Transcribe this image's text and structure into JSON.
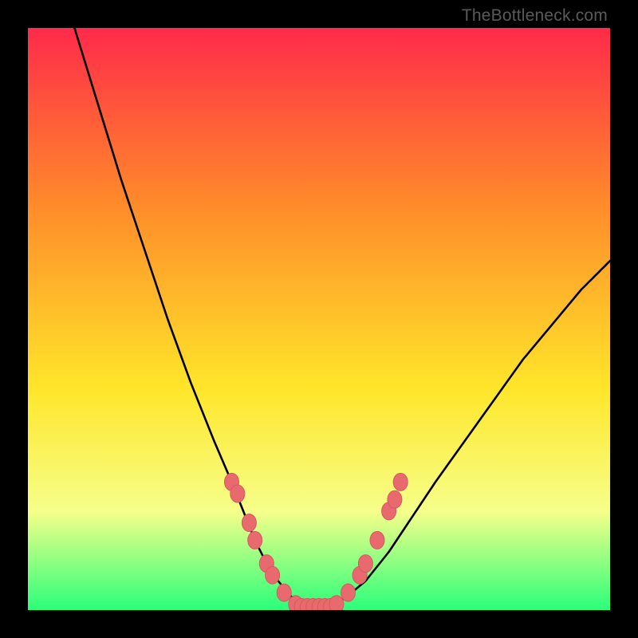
{
  "watermark": "TheBottleneck.com",
  "colors": {
    "gradient_top": "#ff2a4a",
    "gradient_upper_mid": "#ff8a2a",
    "gradient_mid": "#ffe62a",
    "gradient_lower_mid": "#f6ff8a",
    "gradient_bottom": "#2aff7a",
    "curve": "#000000",
    "marker_fill": "#e86a6f",
    "marker_stroke": "#d45a5f",
    "frame": "#000000"
  },
  "chart_data": {
    "type": "line",
    "title": "",
    "xlabel": "",
    "ylabel": "",
    "xlim": [
      0,
      100
    ],
    "ylim": [
      0,
      100
    ],
    "grid": false,
    "legend": false,
    "series": [
      {
        "name": "bottleneck-curve",
        "x": [
          8,
          12,
          16,
          20,
          24,
          28,
          32,
          35,
          37,
          39,
          41,
          43,
          45,
          47,
          49,
          51,
          53,
          55,
          58,
          62,
          66,
          70,
          75,
          80,
          85,
          90,
          95,
          100
        ],
        "y": [
          100,
          87,
          74,
          62,
          50,
          39,
          29,
          22,
          17,
          12,
          8,
          5,
          2.5,
          1.2,
          0.5,
          0.5,
          1.2,
          2.5,
          5,
          10,
          16,
          22,
          29,
          36,
          43,
          49,
          55,
          60
        ]
      }
    ],
    "markers": [
      {
        "x": 35.0,
        "y": 22.0
      },
      {
        "x": 36.0,
        "y": 20.0
      },
      {
        "x": 38.0,
        "y": 15.0
      },
      {
        "x": 39.0,
        "y": 12.0
      },
      {
        "x": 41.0,
        "y": 8.0
      },
      {
        "x": 42.0,
        "y": 6.0
      },
      {
        "x": 44.0,
        "y": 3.0
      },
      {
        "x": 46.0,
        "y": 1.0
      },
      {
        "x": 47.0,
        "y": 0.5
      },
      {
        "x": 48.0,
        "y": 0.5
      },
      {
        "x": 49.0,
        "y": 0.5
      },
      {
        "x": 50.0,
        "y": 0.5
      },
      {
        "x": 51.0,
        "y": 0.5
      },
      {
        "x": 52.0,
        "y": 0.5
      },
      {
        "x": 53.0,
        "y": 1.0
      },
      {
        "x": 55.0,
        "y": 3.0
      },
      {
        "x": 57.0,
        "y": 6.0
      },
      {
        "x": 58.0,
        "y": 8.0
      },
      {
        "x": 60.0,
        "y": 12.0
      },
      {
        "x": 62.0,
        "y": 17.0
      },
      {
        "x": 63.0,
        "y": 19.0
      },
      {
        "x": 64.0,
        "y": 22.0
      }
    ]
  }
}
